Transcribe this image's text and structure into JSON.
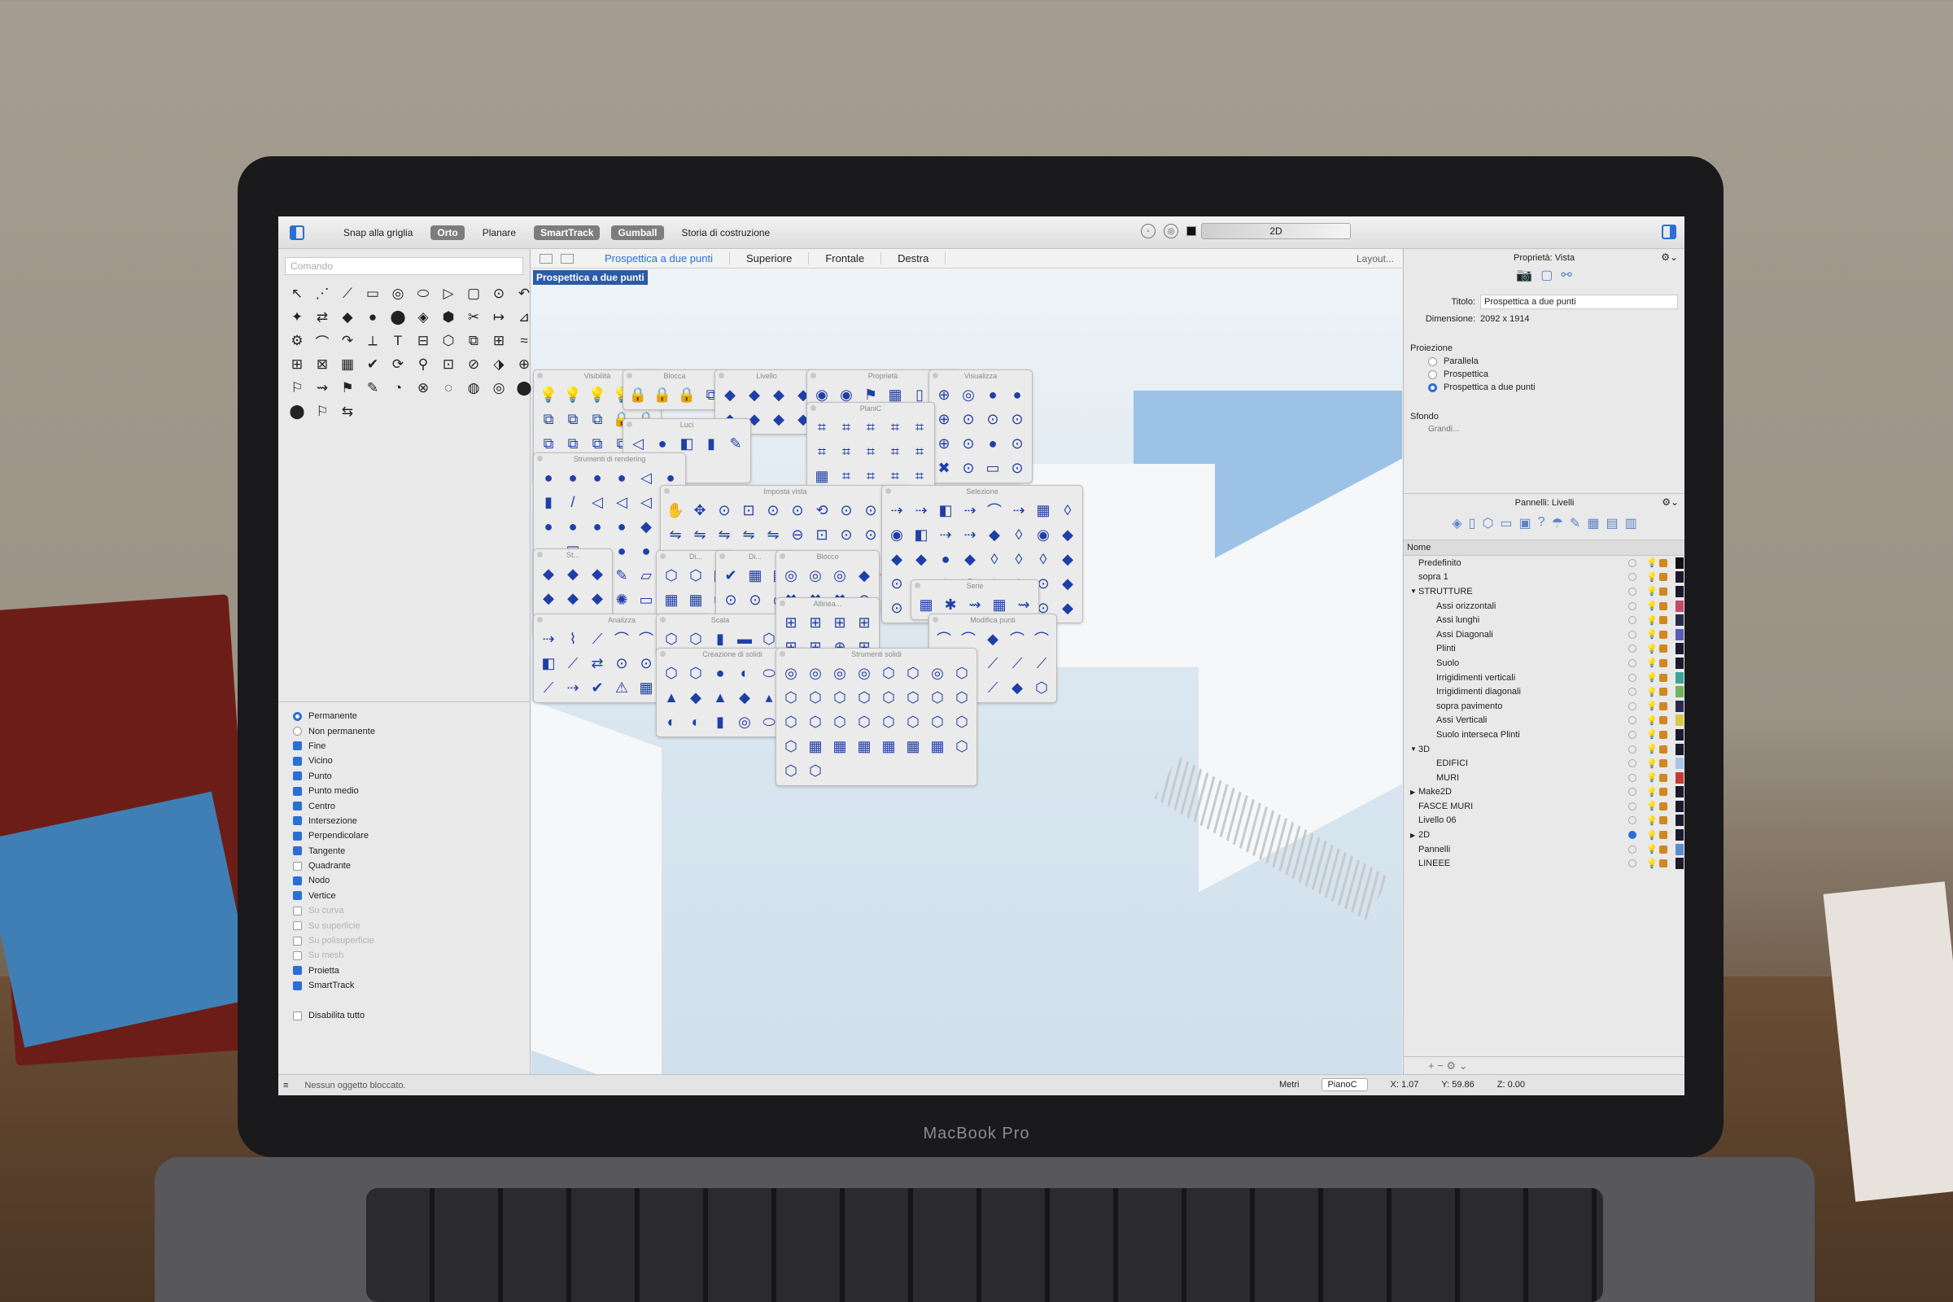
{
  "device": {
    "brand": "MacBook Pro"
  },
  "topbar": {
    "buttons": [
      {
        "label": "Snap alla griglia",
        "on": false
      },
      {
        "label": "Orto",
        "on": true
      },
      {
        "label": "Planare",
        "on": false
      },
      {
        "label": "SmartTrack",
        "on": true
      },
      {
        "label": "Gumball",
        "on": true
      },
      {
        "label": "Storia di costruzione",
        "on": false
      }
    ],
    "layer_field": "2D"
  },
  "left": {
    "command_placeholder": "Comando",
    "tool_icons": [
      "↖",
      "⋰",
      "⟋",
      "▭",
      "◎",
      "⬭",
      "▷",
      "▢",
      "⊙",
      "↶",
      "✦",
      "⇄",
      "◆",
      "●",
      "⬤",
      "◈",
      "⬢",
      "✂",
      "↦",
      "⊿",
      "⚙",
      "⌒",
      "↷",
      "⟂",
      "T",
      "⊟",
      "⬡",
      "⧉",
      "⊞",
      "≈",
      "⊞",
      "⊠",
      "▦",
      "✔",
      "⟳",
      "⚲",
      "⊡",
      "⊘",
      "⬗",
      "⊕",
      "⚐",
      "⇝",
      "⚑",
      "✎",
      "◔",
      "⊗",
      "◌",
      "◍",
      "◎",
      "⬤",
      "⬤",
      "⚐",
      "⇆"
    ],
    "osnap": [
      {
        "label": "Permanente",
        "kind": "radio",
        "on": true
      },
      {
        "label": "Non permanente",
        "kind": "radio",
        "on": false
      },
      {
        "label": "Fine",
        "kind": "check",
        "on": true
      },
      {
        "label": "Vicino",
        "kind": "check",
        "on": true
      },
      {
        "label": "Punto",
        "kind": "check",
        "on": true
      },
      {
        "label": "Punto medio",
        "kind": "check",
        "on": true
      },
      {
        "label": "Centro",
        "kind": "check",
        "on": true
      },
      {
        "label": "Intersezione",
        "kind": "check",
        "on": true
      },
      {
        "label": "Perpendicolare",
        "kind": "check",
        "on": true
      },
      {
        "label": "Tangente",
        "kind": "check",
        "on": true
      },
      {
        "label": "Quadrante",
        "kind": "check",
        "on": false
      },
      {
        "label": "Nodo",
        "kind": "check",
        "on": true
      },
      {
        "label": "Vertice",
        "kind": "check",
        "on": true
      },
      {
        "label": "Su curva",
        "kind": "check",
        "on": false,
        "dim": true
      },
      {
        "label": "Su superficie",
        "kind": "check",
        "on": false,
        "dim": true
      },
      {
        "label": "Su polisuperficie",
        "kind": "check",
        "on": false,
        "dim": true
      },
      {
        "label": "Su mesh",
        "kind": "check",
        "on": false,
        "dim": true
      },
      {
        "label": "Proietta",
        "kind": "check",
        "on": true
      },
      {
        "label": "SmartTrack",
        "kind": "check",
        "on": true
      },
      {
        "label": "",
        "kind": "spacer"
      },
      {
        "label": "Disabilita tutto",
        "kind": "check",
        "on": false
      }
    ]
  },
  "viewport": {
    "tabs": [
      {
        "label": "Prospettica a due punti",
        "active": true
      },
      {
        "label": "Superiore",
        "active": false
      },
      {
        "label": "Frontale",
        "active": false
      },
      {
        "label": "Destra",
        "active": false
      }
    ],
    "layout_link": "Layout...",
    "active_label": "Prospettica a due punti",
    "palettes": [
      {
        "title": "Visibilità",
        "cols": 5,
        "icons": [
          "💡",
          "💡",
          "💡",
          "💡",
          "🔒",
          "⧉",
          "⧉",
          "⧉",
          "🔒",
          "🔒",
          "⧉",
          "⧉",
          "⧉",
          "⧉",
          "⧉",
          "◎",
          "◎",
          "◎",
          "◎",
          "◎"
        ]
      },
      {
        "title": "Blocca",
        "cols": 4,
        "icons": [
          "🔒",
          "🔒",
          "🔒",
          "⧉"
        ]
      },
      {
        "title": "Livello",
        "cols": 4,
        "icons": [
          "◆",
          "◆",
          "◆",
          "◆",
          "◆",
          "◆",
          "◆",
          "◆"
        ]
      },
      {
        "title": "Proprietà",
        "cols": 6,
        "icons": [
          "◉",
          "◉",
          "⚑",
          "▦",
          "▯",
          "⇄"
        ]
      },
      {
        "title": "Visualizza",
        "cols": 4,
        "icons": [
          "⊕",
          "◎",
          "●",
          "●",
          "⊕",
          "⊙",
          "⊙",
          "⊙",
          "⊕",
          "⊙",
          "●",
          "⊙",
          "✖",
          "⊙",
          "▭",
          "⊙"
        ]
      },
      {
        "title": "Luci",
        "cols": 5,
        "icons": [
          "◁",
          "●",
          "◧",
          "▮",
          "✎",
          "●",
          "◁"
        ]
      },
      {
        "title": "PlaniC",
        "cols": 5,
        "icons": [
          "⌗",
          "⌗",
          "⌗",
          "⌗",
          "⌗",
          "⌗",
          "⌗",
          "⌗",
          "⌗",
          "⌗",
          "▦",
          "⌗",
          "⌗",
          "⌗",
          "⌗",
          "▦",
          "▦",
          "⌗",
          "⌗",
          "⌗",
          "⌗",
          "⌗",
          "⌗",
          "⌗",
          "⌗"
        ]
      },
      {
        "title": "Strumenti di rendering",
        "cols": 6,
        "icons": [
          "●",
          "●",
          "●",
          "●",
          "◁",
          "●",
          "▮",
          "/",
          "◁",
          "◁",
          "◁",
          "◁",
          "●",
          "●",
          "●",
          "●",
          "◆",
          "◆",
          "◐",
          "▣",
          "●",
          "●",
          "●",
          "◆",
          "●",
          "■",
          "●",
          "✎",
          "▱",
          "◓",
          "●",
          "▦",
          "▦",
          "✺",
          "▭",
          "▶"
        ]
      },
      {
        "title": "Imposta vista",
        "cols": 10,
        "icons": [
          "✋",
          "✥",
          "⊙",
          "⊡",
          "⊙",
          "⊙",
          "⟲",
          "⊙",
          "⊙",
          "▮",
          "⇋",
          "⇋",
          "⇋",
          "⇋",
          "⇋",
          "⊖",
          "⊡",
          "⊙",
          "⊙",
          "⊙",
          "⊙",
          "⊕",
          "▽",
          "✱",
          "✦",
          "✦",
          "✦",
          "✦",
          "✦",
          "✧"
        ]
      },
      {
        "title": "Selezione",
        "cols": 8,
        "icons": [
          "⇢",
          "⇢",
          "◧",
          "⇢",
          "⌒",
          "⇢",
          "▦",
          "◊",
          "◉",
          "◧",
          "⇢",
          "⇢",
          "◆",
          "◊",
          "◉",
          "◆",
          "◆",
          "◆",
          "●",
          "◆",
          "◊",
          "◊",
          "◊",
          "◆",
          "⊙",
          "⇢",
          "◆",
          "⊙",
          "◆",
          "◆",
          "⊙",
          "◆",
          "⊙",
          "▦",
          "◆",
          "▦",
          "◆",
          "◆",
          "⊙",
          "◆"
        ]
      },
      {
        "title": "St...",
        "cols": 3,
        "icons": [
          "◆",
          "◆",
          "◆",
          "◆",
          "◆",
          "◆",
          "◆",
          "◆",
          "◆"
        ]
      },
      {
        "title": "Di...",
        "cols": 3,
        "icons": [
          "⬡",
          "⬡",
          "▦",
          "▦",
          "▦",
          "⬡",
          "▦",
          "▦",
          "▣"
        ]
      },
      {
        "title": "Di...",
        "cols": 3,
        "icons": [
          "✔",
          "▦",
          "▦",
          "⊙",
          "⊙",
          "◎",
          "✦",
          "✎",
          "▭"
        ]
      },
      {
        "title": "Blocco",
        "cols": 4,
        "icons": [
          "◎",
          "◎",
          "◎",
          "◆",
          "✖",
          "✖",
          "✖",
          "⊙"
        ]
      },
      {
        "title": "Serie",
        "cols": 5,
        "icons": [
          "▦",
          "✱",
          "⇝",
          "▦",
          "⇝"
        ]
      },
      {
        "title": "Analizza",
        "cols": 7,
        "icons": [
          "⇢",
          "⌇",
          "⟋",
          "⌒",
          "⌒",
          "⟋",
          "↘",
          "◧",
          "⟋",
          "⇄",
          "⊙",
          "⊙",
          "▦",
          "◆",
          "⟋",
          "⇢",
          "✔",
          "⚠",
          "▦",
          "≡",
          "◆"
        ]
      },
      {
        "title": "Scala",
        "cols": 5,
        "icons": [
          "⬡",
          "⬡",
          "▮",
          "▬",
          "⬡"
        ]
      },
      {
        "title": "Allinea...",
        "cols": 4,
        "icons": [
          "⊞",
          "⊞",
          "⊞",
          "⊞",
          "⊞",
          "⊞",
          "⊕",
          "⊞"
        ]
      },
      {
        "title": "Modifica punti",
        "cols": 5,
        "icons": [
          "⌒",
          "⌒",
          "◆",
          "⌒",
          "⌒",
          "⟋",
          "⟋",
          "⟋",
          "⟋",
          "⟋",
          "⟋",
          "⟋",
          "⟋",
          "◆",
          "⬡"
        ]
      },
      {
        "title": "Creazione di solidi",
        "cols": 6,
        "icons": [
          "⬡",
          "⬡",
          "●",
          "◐",
          "⬭",
          "◆",
          "▲",
          "◆",
          "▲",
          "◆",
          "▴",
          "⬭",
          "◐",
          "◐",
          "▮",
          "◎",
          "⬭",
          "⬭"
        ]
      },
      {
        "title": "Strumenti solidi",
        "cols": 8,
        "icons": [
          "◎",
          "◎",
          "◎",
          "◎",
          "⬡",
          "⬡",
          "◎",
          "⬡",
          "⬡",
          "⬡",
          "⬡",
          "⬡",
          "⬡",
          "⬡",
          "⬡",
          "⬡",
          "⬡",
          "⬡",
          "⬡",
          "⬡",
          "⬡",
          "⬡",
          "⬡",
          "⬡",
          "⬡",
          "▦",
          "▦",
          "▦",
          "▦",
          "▦",
          "▦",
          "⬡",
          "⬡",
          "⬡"
        ]
      }
    ]
  },
  "right": {
    "properties_title": "Proprietà: Vista",
    "title_label": "Titolo:",
    "title_value": "Prospettica a due punti",
    "dimension_label": "Dimensione:",
    "dimension_value": "2092 x 1914",
    "projection_label": "Proiezione",
    "projection_options": [
      {
        "label": "Parallela",
        "on": false
      },
      {
        "label": "Prospettica",
        "on": false
      },
      {
        "label": "Prospettica a due punti",
        "on": true
      }
    ],
    "background_label": "Sfondo",
    "background_value": "Grandi...",
    "layers_title": "Pannelli: Livelli",
    "layers_header": "Nome",
    "layers": [
      {
        "name": "Predefinito",
        "indent": 0,
        "arrow": "",
        "color": "#111111"
      },
      {
        "name": "sopra 1",
        "indent": 0,
        "arrow": "",
        "color": "#1a1a2e"
      },
      {
        "name": "STRUTTURE",
        "indent": 0,
        "arrow": "▼",
        "color": "#1a1a2e"
      },
      {
        "name": "Assi orizzontali",
        "indent": 1,
        "arrow": "",
        "color": "#c44c6a"
      },
      {
        "name": "Assi lunghi",
        "indent": 1,
        "arrow": "",
        "color": "#2a2a4a"
      },
      {
        "name": "Assi Diagonali",
        "indent": 1,
        "arrow": "",
        "color": "#5b5bb3"
      },
      {
        "name": "Plinti",
        "indent": 1,
        "arrow": "",
        "color": "#1a1a2e"
      },
      {
        "name": "Suolo",
        "indent": 1,
        "arrow": "",
        "color": "#1a1a2e"
      },
      {
        "name": "Irrigidimenti verticali",
        "indent": 1,
        "arrow": "",
        "color": "#3ea39b"
      },
      {
        "name": "Irrigidimenti diagonali",
        "indent": 1,
        "arrow": "",
        "color": "#6fb35c"
      },
      {
        "name": "sopra pavimento",
        "indent": 1,
        "arrow": "",
        "color": "#2a2a4a"
      },
      {
        "name": "Assi Verticali",
        "indent": 1,
        "arrow": "",
        "color": "#d9c84a"
      },
      {
        "name": "Suolo interseca Plinti",
        "indent": 1,
        "arrow": "",
        "color": "#1a1a2e"
      },
      {
        "name": "3D",
        "indent": 0,
        "arrow": "▼",
        "color": "#1a1a2e"
      },
      {
        "name": "EDIFICI",
        "indent": 1,
        "arrow": "",
        "color": "#a7c6e6"
      },
      {
        "name": "MURI",
        "indent": 1,
        "arrow": "",
        "color": "#c43a3a"
      },
      {
        "name": "Make2D",
        "indent": 0,
        "arrow": "▶",
        "color": "#1a1a2e"
      },
      {
        "name": "FASCE MURI",
        "indent": 0,
        "arrow": "",
        "color": "#1a1a2e"
      },
      {
        "name": "Livello 06",
        "indent": 0,
        "arrow": "",
        "color": "#1a1a2e"
      },
      {
        "name": "2D",
        "indent": 0,
        "arrow": "▶",
        "color": "#1a1a2e",
        "current": true
      },
      {
        "name": "Pannelli",
        "indent": 0,
        "arrow": "",
        "color": "#5a8ed0"
      },
      {
        "name": "LINEEE",
        "indent": 0,
        "arrow": "",
        "color": "#1a1a2e"
      }
    ],
    "footer": "+  −          ⚙ ⌄"
  },
  "status": {
    "message": "Nessun oggetto bloccato.",
    "units": "Metri",
    "plane": "PianoC",
    "x": "X: 1.07",
    "y": "Y: 59.86",
    "z": "Z: 0.00"
  }
}
